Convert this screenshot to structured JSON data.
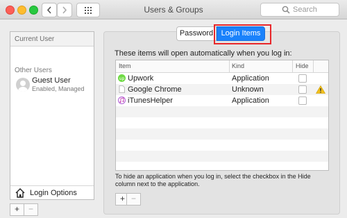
{
  "window": {
    "title": "Users & Groups",
    "search_placeholder": "Search",
    "traffic_colors": {
      "close": "#fc5f57",
      "minimize": "#fdbc2e",
      "zoom": "#28c840"
    }
  },
  "sidebar": {
    "current_user_label": "Current User",
    "other_users_label": "Other Users",
    "guest": {
      "name": "Guest User",
      "status": "Enabled, Managed"
    },
    "login_options_label": "Login Options",
    "add_label": "+",
    "remove_label": "−"
  },
  "tabs": [
    {
      "label": "Password",
      "selected": false
    },
    {
      "label": "Login Items",
      "selected": true
    }
  ],
  "login_items": {
    "description": "These items will open automatically when you log in:",
    "columns": {
      "item": "Item",
      "kind": "Kind",
      "hide": "Hide"
    },
    "rows": [
      {
        "name": "Upwork",
        "kind": "Application",
        "icon": "upwork-icon",
        "hidden": false,
        "warning": false
      },
      {
        "name": "Google Chrome",
        "kind": "Unknown",
        "icon": "document-icon",
        "hidden": false,
        "warning": true
      },
      {
        "name": "iTunesHelper",
        "kind": "Application",
        "icon": "itunes-icon",
        "hidden": false,
        "warning": false
      }
    ],
    "footnote": "To hide an application when you log in, select the checkbox in the Hide column next to the application.",
    "add_label": "+",
    "remove_label": "−"
  },
  "colors": {
    "accent": "#1a82fb",
    "highlight_box": "#e8262a",
    "warning": "#f2c01c"
  }
}
